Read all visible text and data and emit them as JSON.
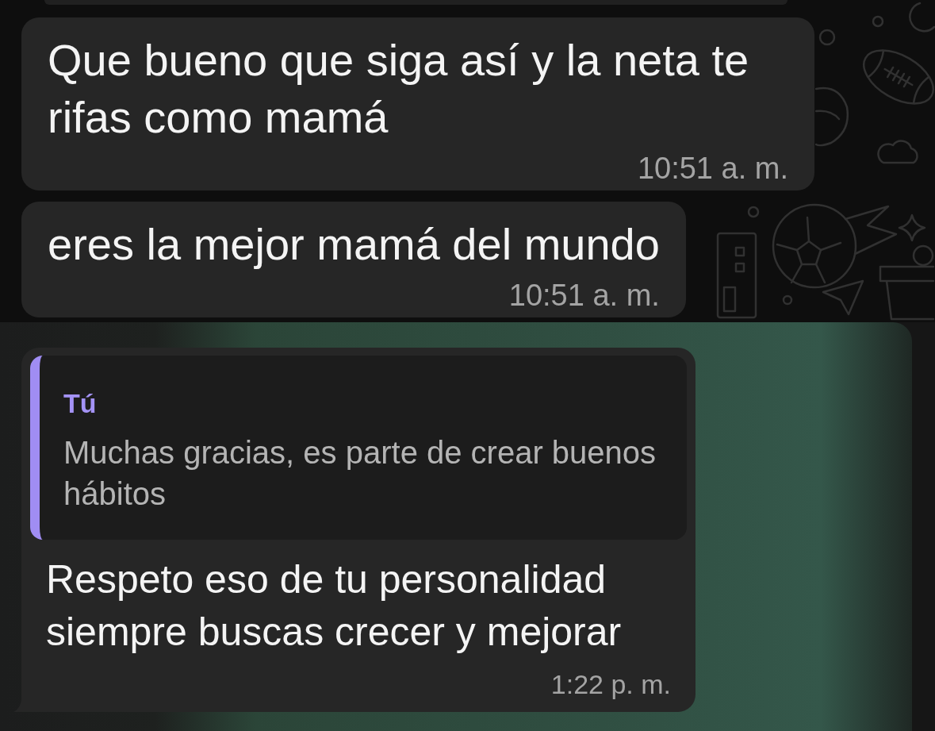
{
  "messages": [
    {
      "kind": "text",
      "text": "Que bueno que siga así y la neta te rifas como mamá",
      "time": "10:51 a. m.",
      "highlighted": false,
      "tail": false
    },
    {
      "kind": "text",
      "text": "eres la mejor mamá del mundo",
      "time": "10:51 a. m.",
      "highlighted": false,
      "tail": false
    },
    {
      "kind": "reply",
      "quote": {
        "author": "Tú",
        "text": "Muchas gracias, es parte de crear buenos hábitos"
      },
      "text": "Respeto eso de tu personalidad siempre buscas crecer y mejorar",
      "time": "1:22 p. m.",
      "highlighted": true,
      "tail": true
    }
  ]
}
